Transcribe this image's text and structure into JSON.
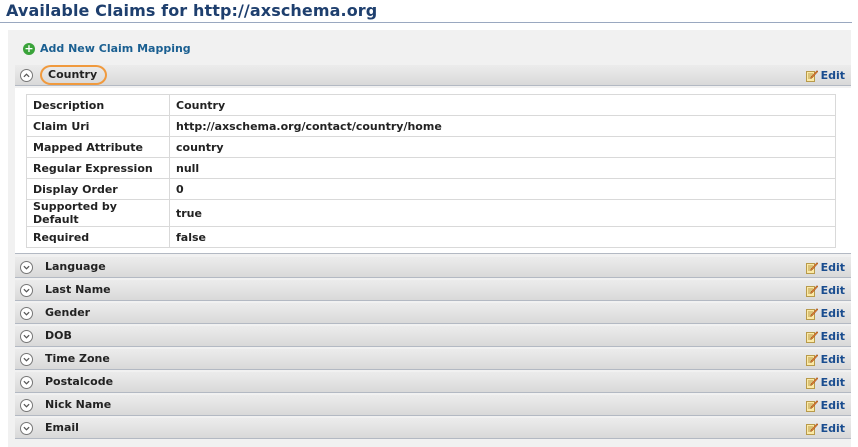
{
  "header": {
    "title": "Available Claims for http://axschema.org"
  },
  "toolbar": {
    "add_label": "Add New Claim Mapping"
  },
  "edit_label": "Edit",
  "claims": [
    {
      "name": "Country",
      "expanded": true,
      "details": [
        {
          "key": "Description",
          "value": "Country"
        },
        {
          "key": "Claim Uri",
          "value": "http://axschema.org/contact/country/home"
        },
        {
          "key": "Mapped Attribute",
          "value": "country"
        },
        {
          "key": "Regular Expression",
          "value": "null"
        },
        {
          "key": "Display Order",
          "value": "0"
        },
        {
          "key": "Supported by Default",
          "value": "true"
        },
        {
          "key": "Required",
          "value": "false"
        }
      ]
    },
    {
      "name": "Language"
    },
    {
      "name": "Last Name"
    },
    {
      "name": "Gender"
    },
    {
      "name": "DOB"
    },
    {
      "name": "Time Zone"
    },
    {
      "name": "Postalcode"
    },
    {
      "name": "Nick Name"
    },
    {
      "name": "Email"
    }
  ],
  "colors": {
    "title": "#1e3f6e",
    "link": "#1a5f91",
    "highlight_ring": "#f09a3e",
    "add_icon": "#3aa33a"
  },
  "icons": {
    "add": "plus-circle-icon",
    "edit": "pencil-note-icon",
    "expand": "chevron-down-icon",
    "collapse": "chevron-up-icon"
  }
}
